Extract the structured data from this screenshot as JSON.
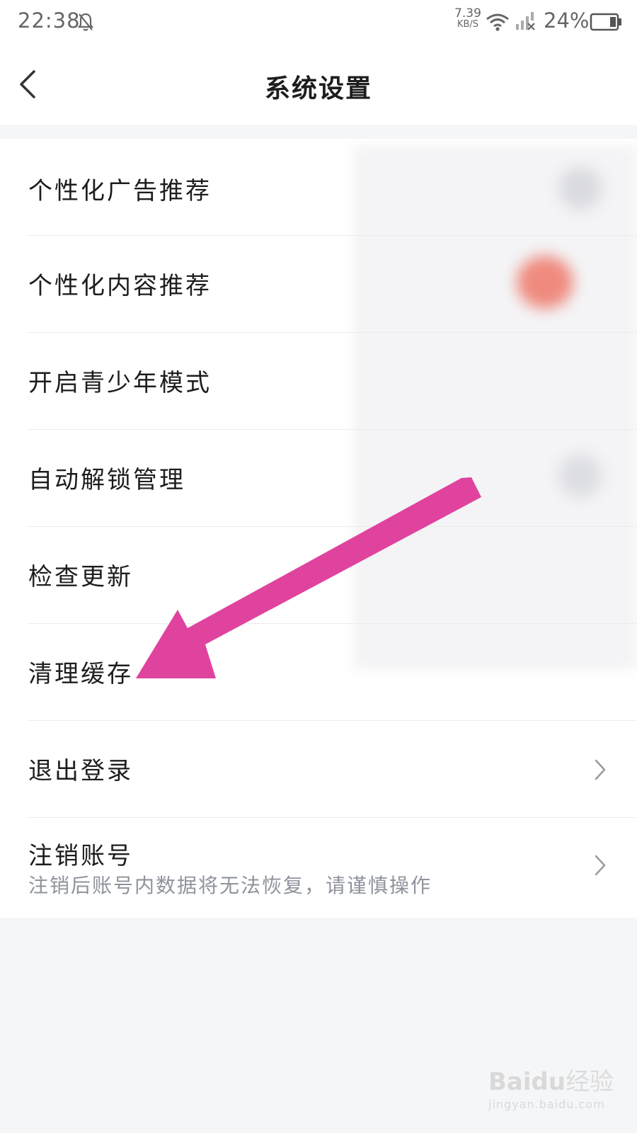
{
  "status_bar": {
    "time": "22:38",
    "speed_value": "7.39",
    "speed_unit": "KB/S",
    "battery": "24%",
    "icons": [
      "mute-bell-icon",
      "wifi-icon",
      "cellular-signal-icon",
      "battery-icon"
    ]
  },
  "header": {
    "title": "系统设置",
    "back_icon": "chevron-left-icon"
  },
  "settings": {
    "items": [
      {
        "label": "个性化广告推荐"
      },
      {
        "label": "个性化内容推荐"
      },
      {
        "label": "开启青少年模式"
      },
      {
        "label": "自动解锁管理"
      },
      {
        "label": "检查更新"
      },
      {
        "label": "清理缓存"
      },
      {
        "label": "退出登录"
      },
      {
        "label": "注销账号",
        "sublabel": "注销后账号内数据将无法恢复，请谨慎操作"
      }
    ]
  },
  "annotation": {
    "color": "#e0439e"
  },
  "colors": {
    "background": "#f5f6f8",
    "card": "#ffffff",
    "text": "#1d1d1f",
    "subtext": "#8e939c",
    "toggle_on": "#ef8a7e"
  },
  "watermark": {
    "brand": "Bai",
    "brand_suffix": "du",
    "product": "经验",
    "url": "jingyan.baidu.com"
  }
}
